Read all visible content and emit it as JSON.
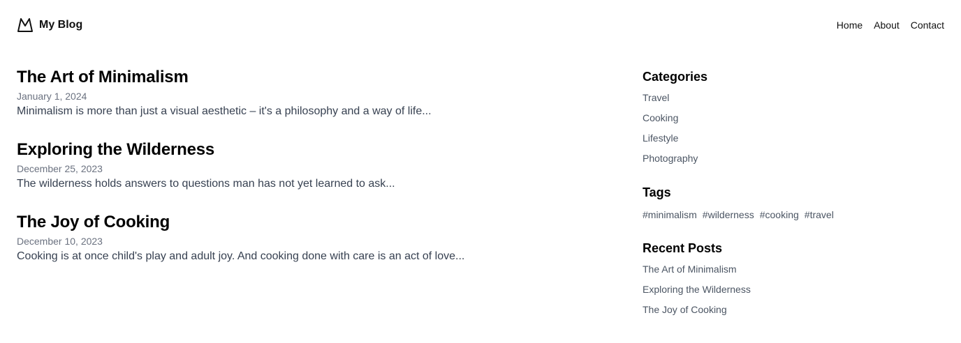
{
  "header": {
    "brand_name": "My Blog",
    "logo_icon": "mountain-icon",
    "nav": [
      {
        "label": "Home"
      },
      {
        "label": "About"
      },
      {
        "label": "Contact"
      }
    ]
  },
  "posts": [
    {
      "title": "The Art of Minimalism",
      "date": "January 1, 2024",
      "excerpt": "Minimalism is more than just a visual aesthetic – it's a philosophy and a way of life..."
    },
    {
      "title": "Exploring the Wilderness",
      "date": "December 25, 2023",
      "excerpt": "The wilderness holds answers to questions man has not yet learned to ask..."
    },
    {
      "title": "The Joy of Cooking",
      "date": "December 10, 2023",
      "excerpt": "Cooking is at once child's play and adult joy. And cooking done with care is an act of love..."
    }
  ],
  "sidebar": {
    "categories": {
      "title": "Categories",
      "items": [
        "Travel",
        "Cooking",
        "Lifestyle",
        "Photography"
      ]
    },
    "tags": {
      "title": "Tags",
      "items": [
        "#minimalism",
        "#wilderness",
        "#cooking",
        "#travel"
      ]
    },
    "recent_posts": {
      "title": "Recent Posts",
      "items": [
        "The Art of Minimalism",
        "Exploring the Wilderness",
        "The Joy of Cooking"
      ]
    }
  },
  "colors": {
    "text": "#111111",
    "muted": "#6b7280",
    "excerpt": "#374151",
    "link": "#4b5563",
    "background": "#ffffff"
  }
}
